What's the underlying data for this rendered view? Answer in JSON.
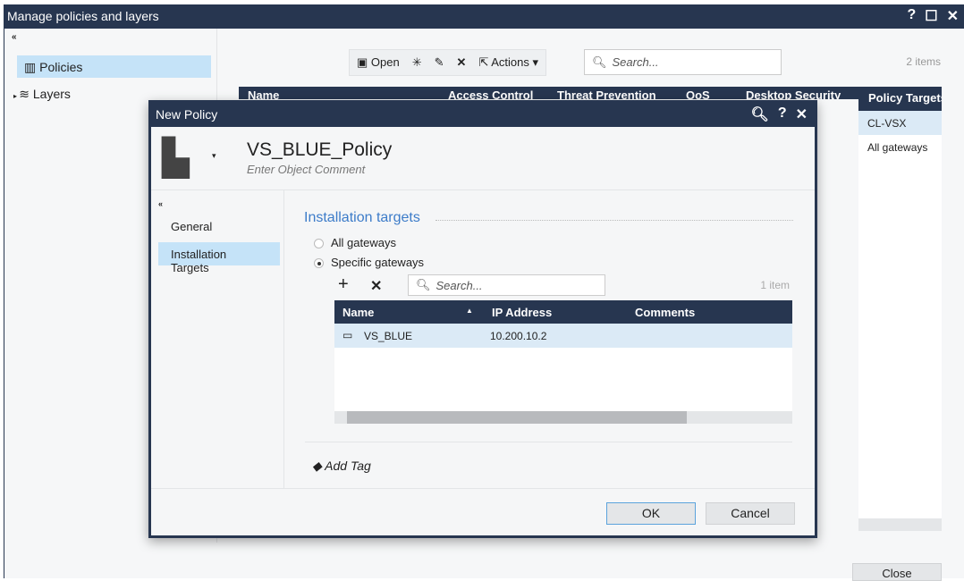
{
  "window": {
    "title": "Manage policies and layers",
    "help": "?",
    "maximize": "☐",
    "close": "✕",
    "collapse": "«"
  },
  "sidebar": {
    "items": [
      {
        "label": "Policies",
        "icon": "policies-icon"
      },
      {
        "label": "Layers",
        "icon": "layers-icon"
      }
    ]
  },
  "toolbar": {
    "open": "Open",
    "actions": "Actions ▾",
    "search_placeholder": "Search...",
    "count": "2 items"
  },
  "grid": {
    "columns": [
      "Name",
      "Access Control",
      "Threat Prevention",
      "QoS",
      "Desktop Security",
      "Policy Targets"
    ],
    "policy_targets": [
      "CL-VSX",
      "All gateways"
    ]
  },
  "close_button": "Close",
  "dialog": {
    "title": "New Policy",
    "name": "VS_BLUE_Policy",
    "comment_placeholder": "Enter Object Comment",
    "nav": [
      "General",
      "Installation Targets"
    ],
    "section_title": "Installation targets",
    "options": [
      {
        "label": "All gateways",
        "selected": false
      },
      {
        "label": "Specific gateways",
        "selected": true
      }
    ],
    "search_placeholder": "Search...",
    "count": "1 item",
    "columns": [
      "Name",
      "IP Address",
      "Comments"
    ],
    "rows": [
      {
        "name": "VS_BLUE",
        "ip": "10.200.10.2",
        "comments": ""
      }
    ],
    "add_tag": "Add Tag",
    "ok": "OK",
    "cancel": "Cancel"
  },
  "colors": {
    "header": "#273650",
    "selection": "#c5e3f8",
    "accent": "#3d7cc9"
  }
}
